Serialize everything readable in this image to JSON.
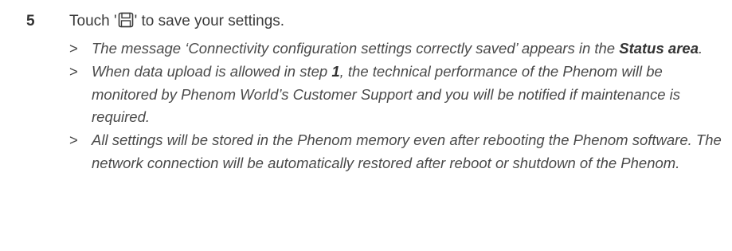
{
  "step": {
    "number": "5",
    "text_before": "Touch '",
    "icon": "save-icon",
    "text_after": "' to save your settings."
  },
  "results": [
    {
      "marker": ">",
      "parts": [
        "The message ‘Connectivity configuration settings correctly saved’ appears in the ",
        "Status area",
        "."
      ]
    },
    {
      "marker": ">",
      "parts": [
        "When data upload is allowed in step ",
        "1",
        ", the technical performance of the Phenom will be monitored by Phenom World’s Customer Support and you will be notified if maintenance is required."
      ]
    },
    {
      "marker": ">",
      "text": "All settings will be stored in the Phenom memory even after rebooting the Phenom software. The network connection will be automatically restored after reboot or shutdown of the Phenom."
    }
  ]
}
